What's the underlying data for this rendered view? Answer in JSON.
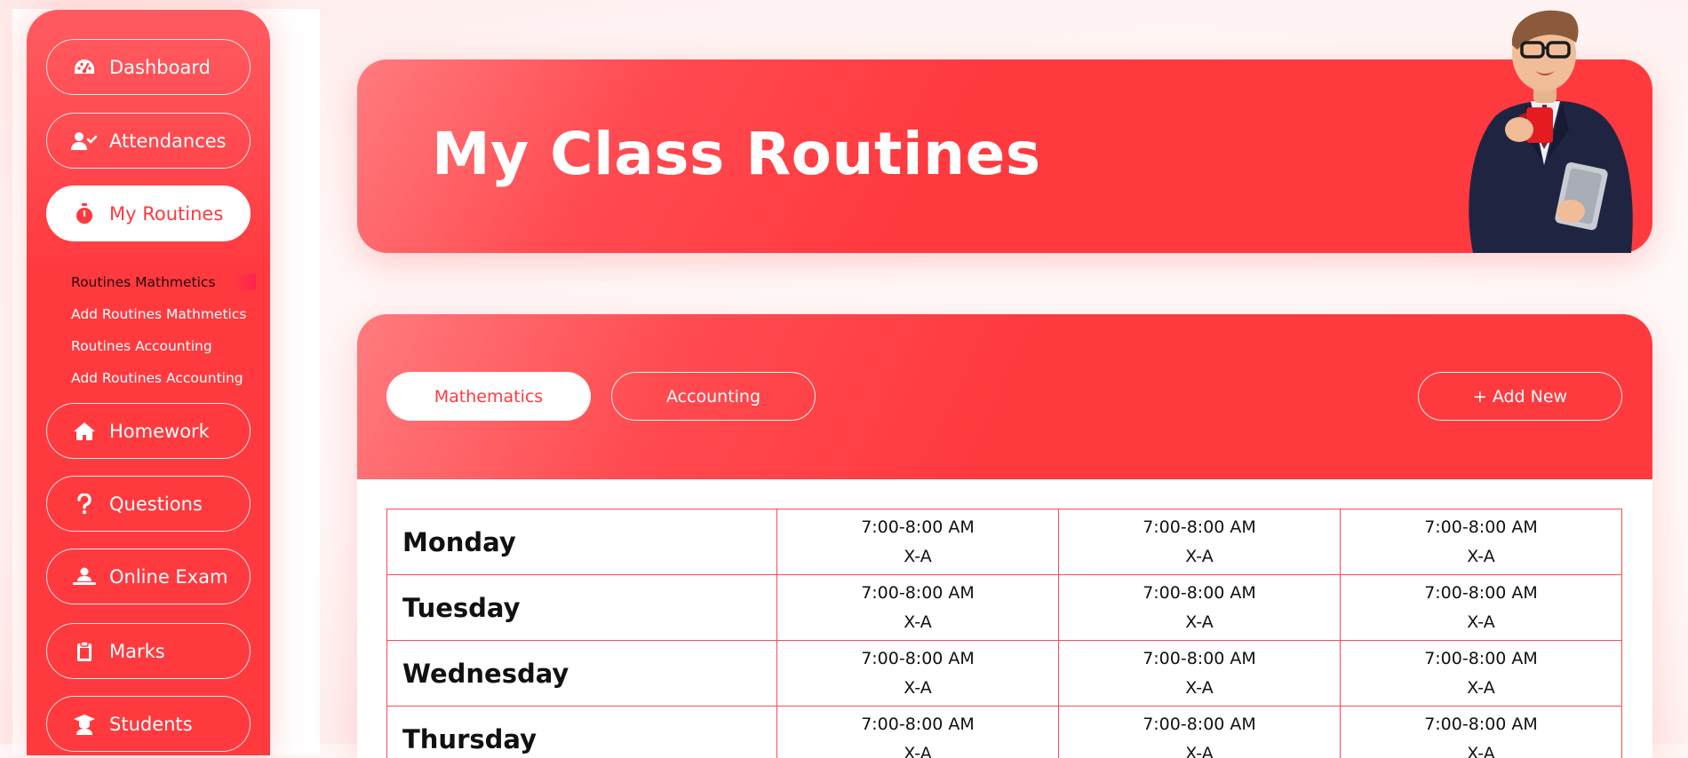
{
  "sidebar": {
    "items": [
      {
        "label": "Dashboard",
        "icon": "gauge-icon"
      },
      {
        "label": "Attendances",
        "icon": "user-check-icon"
      },
      {
        "label": "My Routines",
        "icon": "stopwatch-icon",
        "active": true
      },
      {
        "label": "Homework",
        "icon": "home-icon"
      },
      {
        "label": "Questions",
        "icon": "question-icon"
      },
      {
        "label": "Online Exam",
        "icon": "laptop-user-icon"
      },
      {
        "label": "Marks",
        "icon": "clipboard-icon"
      },
      {
        "label": "Students",
        "icon": "graduate-icon"
      }
    ],
    "sub_items": [
      {
        "label": "Routines Mathmetics",
        "current": true
      },
      {
        "label": "Add Routines Mathmetics"
      },
      {
        "label": "Routines Accounting"
      },
      {
        "label": "Add Routines Accounting"
      }
    ]
  },
  "header": {
    "title": "My Class Routines"
  },
  "tabs": [
    {
      "label": "Mathematics",
      "active": true
    },
    {
      "label": "Accounting"
    }
  ],
  "add_button": {
    "label": "+ Add New"
  },
  "routine": {
    "rows": [
      {
        "day": "Monday",
        "slots": [
          {
            "time": "7:00-8:00 AM",
            "class": "X-A"
          },
          {
            "time": "7:00-8:00 AM",
            "class": "X-A"
          },
          {
            "time": "7:00-8:00 AM",
            "class": "X-A"
          }
        ]
      },
      {
        "day": "Tuesday",
        "slots": [
          {
            "time": "7:00-8:00 AM",
            "class": "X-A"
          },
          {
            "time": "7:00-8:00 AM",
            "class": "X-A"
          },
          {
            "time": "7:00-8:00 AM",
            "class": "X-A"
          }
        ]
      },
      {
        "day": "Wednesday",
        "slots": [
          {
            "time": "7:00-8:00 AM",
            "class": "X-A"
          },
          {
            "time": "7:00-8:00 AM",
            "class": "X-A"
          },
          {
            "time": "7:00-8:00 AM",
            "class": "X-A"
          }
        ]
      },
      {
        "day": "Thursday",
        "slots": [
          {
            "time": "7:00-8:00 AM",
            "class": "X-A"
          },
          {
            "time": "7:00-8:00 AM",
            "class": "X-A"
          },
          {
            "time": "7:00-8:00 AM",
            "class": "X-A"
          }
        ]
      }
    ]
  },
  "colors": {
    "accent": "#ff3a3f",
    "accent_light": "#ff7b7e",
    "text": "#111111",
    "white": "#ffffff"
  }
}
